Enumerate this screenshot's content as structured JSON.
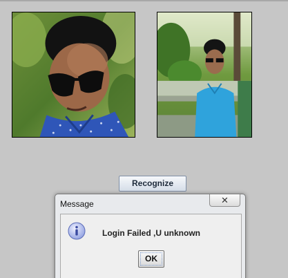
{
  "photos": [
    {
      "name": "photo-left",
      "description": "man in sunglasses and blue shirt"
    },
    {
      "name": "photo-right",
      "description": "man sitting on bench"
    }
  ],
  "actions": {
    "recognize_label": "Recognize"
  },
  "dialog": {
    "title": "Message",
    "close_symbol": "✕",
    "icon": "info-icon",
    "message": "Login Failed ,U unknown",
    "ok_label": "OK"
  },
  "colors": {
    "background": "#c6c6c6",
    "dialog_bg": "#e8eaed",
    "info_icon": "#7b8fd4"
  }
}
